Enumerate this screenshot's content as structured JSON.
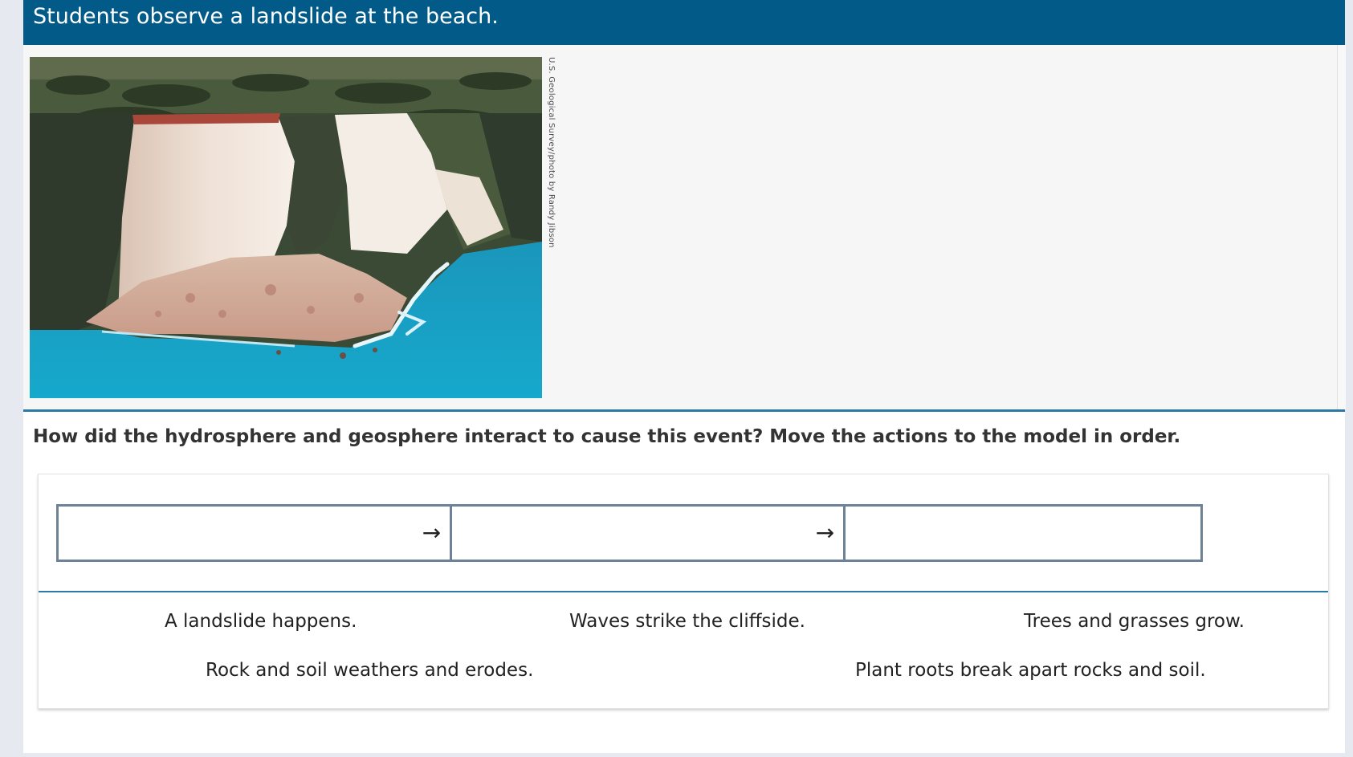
{
  "header": {
    "title": "Students observe a landslide at the beach."
  },
  "stimulus": {
    "image_alt": "Aerial photo of a white cliff collapsed onto a turquoise sea shore",
    "photo_credit": "U.S. Geological Survey/photo by Randy Jibson",
    "watermark": "USGS"
  },
  "question": {
    "text": "How did the hydrosphere and geosphere interact to cause this event? Move the actions to the model in order."
  },
  "model": {
    "slots": [
      "",
      "",
      ""
    ],
    "arrow_glyph": "→"
  },
  "tiles": [
    {
      "label": "A landslide happens."
    },
    {
      "label": "Waves strike the cliffside."
    },
    {
      "label": "Trees and grasses grow."
    },
    {
      "label": "Rock and soil weathers and erodes."
    },
    {
      "label": "Plant roots break apart rocks and soil."
    }
  ],
  "colors": {
    "header_bg": "#025a88",
    "accent_line": "#2b79a6",
    "box_border": "#6d8197",
    "sea": "#1aa0c4",
    "cliff": "#e8d3c6"
  }
}
